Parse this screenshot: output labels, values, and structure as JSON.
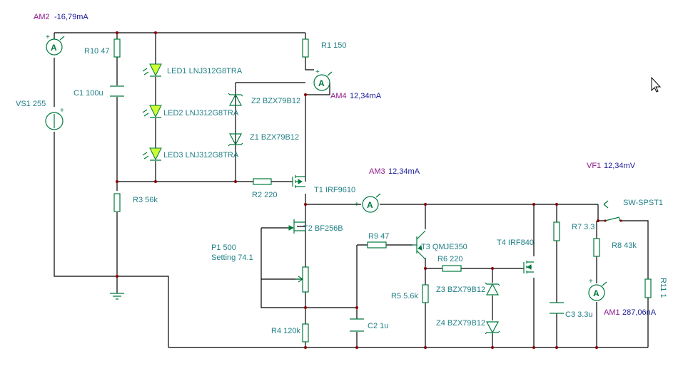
{
  "meters": {
    "am2": {
      "name": "AM2",
      "value": "-16,79mA"
    },
    "am4": {
      "name": "AM4",
      "value": "12,34mA"
    },
    "am3": {
      "name": "AM3",
      "value": "12,34mA"
    },
    "vf1": {
      "name": "VF1",
      "value": "12,34mV"
    },
    "am1": {
      "name": "AM1",
      "value": "287,06nA"
    }
  },
  "meter_symbol": "A",
  "plus_sign": "+",
  "components": {
    "vs1": "VS1 255",
    "r10": "R10 47",
    "c1": "C1 100u",
    "led1": "LED1 LNJ312G8TRA",
    "led2": "LED2 LNJ312G8TRA",
    "led3": "LED3 LNJ312G8TRA",
    "r1": "R1 150",
    "z2": "Z2 BZX79B12",
    "z1": "Z1 BZX79B12",
    "r2": "R2 220",
    "t1": "T1 IRF9610",
    "r3": "R3 56k",
    "t2": "T2 BF256B",
    "p1": "P1 500",
    "p1_setting": "Setting 74.1",
    "r4": "R4 120k",
    "c2": "C2 1u",
    "r9": "R9 47",
    "t3": "T3 QMJE350",
    "r6": "R6 220",
    "r5": "R5 5.6k",
    "z3": "Z3 BZX79B12",
    "z4": "Z4 BZX79B12",
    "t4": "T4 IRF840",
    "c3": "C3 3.3u",
    "r7": "R7 3.3",
    "r8": "R8 43k",
    "sw": "SW-SPST1",
    "r11": "R11 1"
  },
  "colors": {
    "wire": "#000000",
    "component": "#007a3d",
    "label": "#1f7f86",
    "meter_name": "#8b1a8b",
    "meter_value": "#1a1a99",
    "node": "#8b0000",
    "led_fill": "#ccff33"
  }
}
